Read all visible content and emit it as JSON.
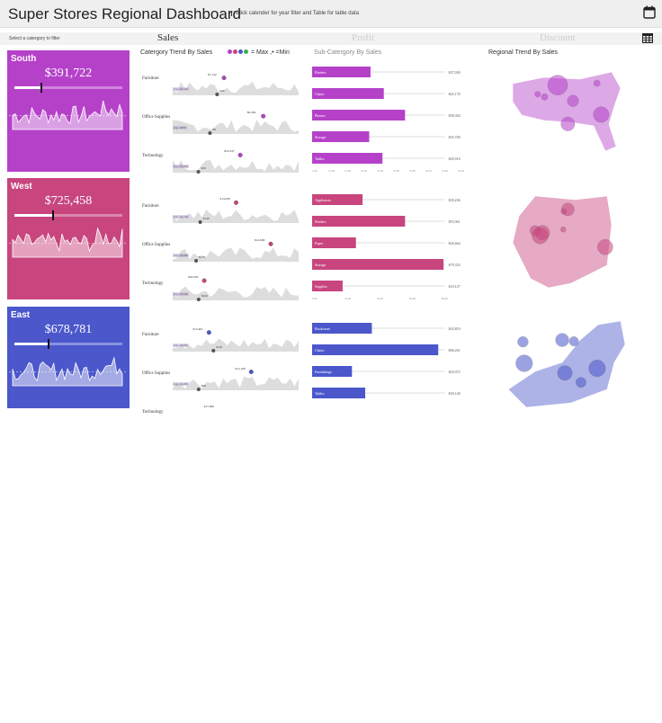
{
  "header": {
    "title": "Super Stores Regional Dashboard",
    "subtitle": "Click calender for year filter and Table for table data",
    "calendar_icon": "calendar-icon"
  },
  "tabbar": {
    "filter_hint": "Select a catergory to filter",
    "tabs": [
      {
        "label": "Sales",
        "active": true
      },
      {
        "label": "Profit",
        "active": false
      },
      {
        "label": "Discount",
        "active": false
      }
    ],
    "table_icon": "table-icon"
  },
  "columns": {
    "trend_title": "Catergory Trend By Sales",
    "legend": "= Max ,• =Min",
    "subcat_title": "Sub-Catergory By Sales",
    "regional_title": "Regional Trend By Sales"
  },
  "colors": {
    "south": "#b541c9",
    "west": "#c8457e",
    "east": "#4b57cb",
    "legend_dots": [
      "#b541c9",
      "#c8457e",
      "#4b57cb",
      "#3cae4f"
    ]
  },
  "regions": [
    {
      "key": "south",
      "name": "South",
      "value": "$391,722",
      "progress": 0.25,
      "categories": [
        "Furniture",
        "Office Supplies",
        "Technology"
      ],
      "trend": [
        {
          "label": "Furniture",
          "max": "$7,142",
          "min": "$46",
          "avg": "avg = $1,552"
        },
        {
          "label": "Office Supplies",
          "max": "$6,390",
          "min": "$8",
          "avg": "avg = $976",
          "minlabel": "$18,5"
        },
        {
          "label": "Technology",
          "max": "$18,347",
          "min": "$29",
          "avg": "avg = $1,084"
        }
      ],
      "subcat": [
        {
          "label": "Binders",
          "value": "$37,030",
          "frac": 0.44
        },
        {
          "label": "Chairs",
          "value": "$45,176",
          "frac": 0.54
        },
        {
          "label": "Phones",
          "value": "$58,304",
          "frac": 0.7
        },
        {
          "label": "Storage",
          "value": "$35,768",
          "frac": 0.43
        },
        {
          "label": "Tables",
          "value": "$43,916",
          "frac": 0.53
        }
      ],
      "axis": [
        "5.0K",
        "10.0K",
        "15.0K",
        "20.0K",
        "25.0K",
        "30.0K",
        "35.0K",
        "40.0K",
        "45.0K",
        "50.0K"
      ]
    },
    {
      "key": "west",
      "name": "West",
      "value": "$725,458",
      "progress": 0.36,
      "categories": [
        "Furniture",
        "Office Supplies",
        "Technology"
      ],
      "trend": [
        {
          "label": "Furniture",
          "max": "$14,930",
          "min": "$149",
          "avg": "avg = $2,183"
        },
        {
          "label": "Office Supplies",
          "max": "$14,680",
          "min": "$175",
          "avg": "avg = $2,680"
        },
        {
          "label": "Technology",
          "max": "$20,392",
          "min": "$226",
          "avg": "avg = $3,180"
        }
      ],
      "subcat": [
        {
          "label": "Appliances",
          "value": "$30,236",
          "frac": 0.38
        },
        {
          "label": "Binders",
          "value": "$55,961",
          "frac": 0.7
        },
        {
          "label": "Paper",
          "value": "$26,664",
          "frac": 0.33
        },
        {
          "label": "Storage",
          "value": "$79,333",
          "frac": 0.99
        },
        {
          "label": "Supplies",
          "value": "$18,127",
          "frac": 0.23
        }
      ],
      "axis": [
        "0.0K",
        "20.0K",
        "40.0K",
        "60.0K",
        "80.0K"
      ]
    },
    {
      "key": "east",
      "name": "East",
      "value": "$678,781",
      "progress": 0.32,
      "categories": [
        "Furniture",
        "Office Supplies",
        "Technology"
      ],
      "trend": [
        {
          "label": "Furniture",
          "max": "$15,401",
          "min": "$195",
          "avg": "avg = $2,850"
        },
        {
          "label": "Office Supplies",
          "max": "$12,166",
          "min": "$69",
          "avg": "avg = $2,284"
        },
        {
          "label": "Technology",
          "max": "$17,999",
          "min": "",
          "avg": ""
        }
      ],
      "subcat": [
        {
          "label": "Bookcases",
          "value": "$43,819",
          "frac": 0.45
        },
        {
          "label": "Chairs",
          "value": "$96,261",
          "frac": 0.95
        },
        {
          "label": "Furnishings",
          "value": "$29,072",
          "frac": 0.3
        },
        {
          "label": "Tables",
          "value": "$39,140",
          "frac": 0.4
        }
      ],
      "axis": []
    }
  ]
}
